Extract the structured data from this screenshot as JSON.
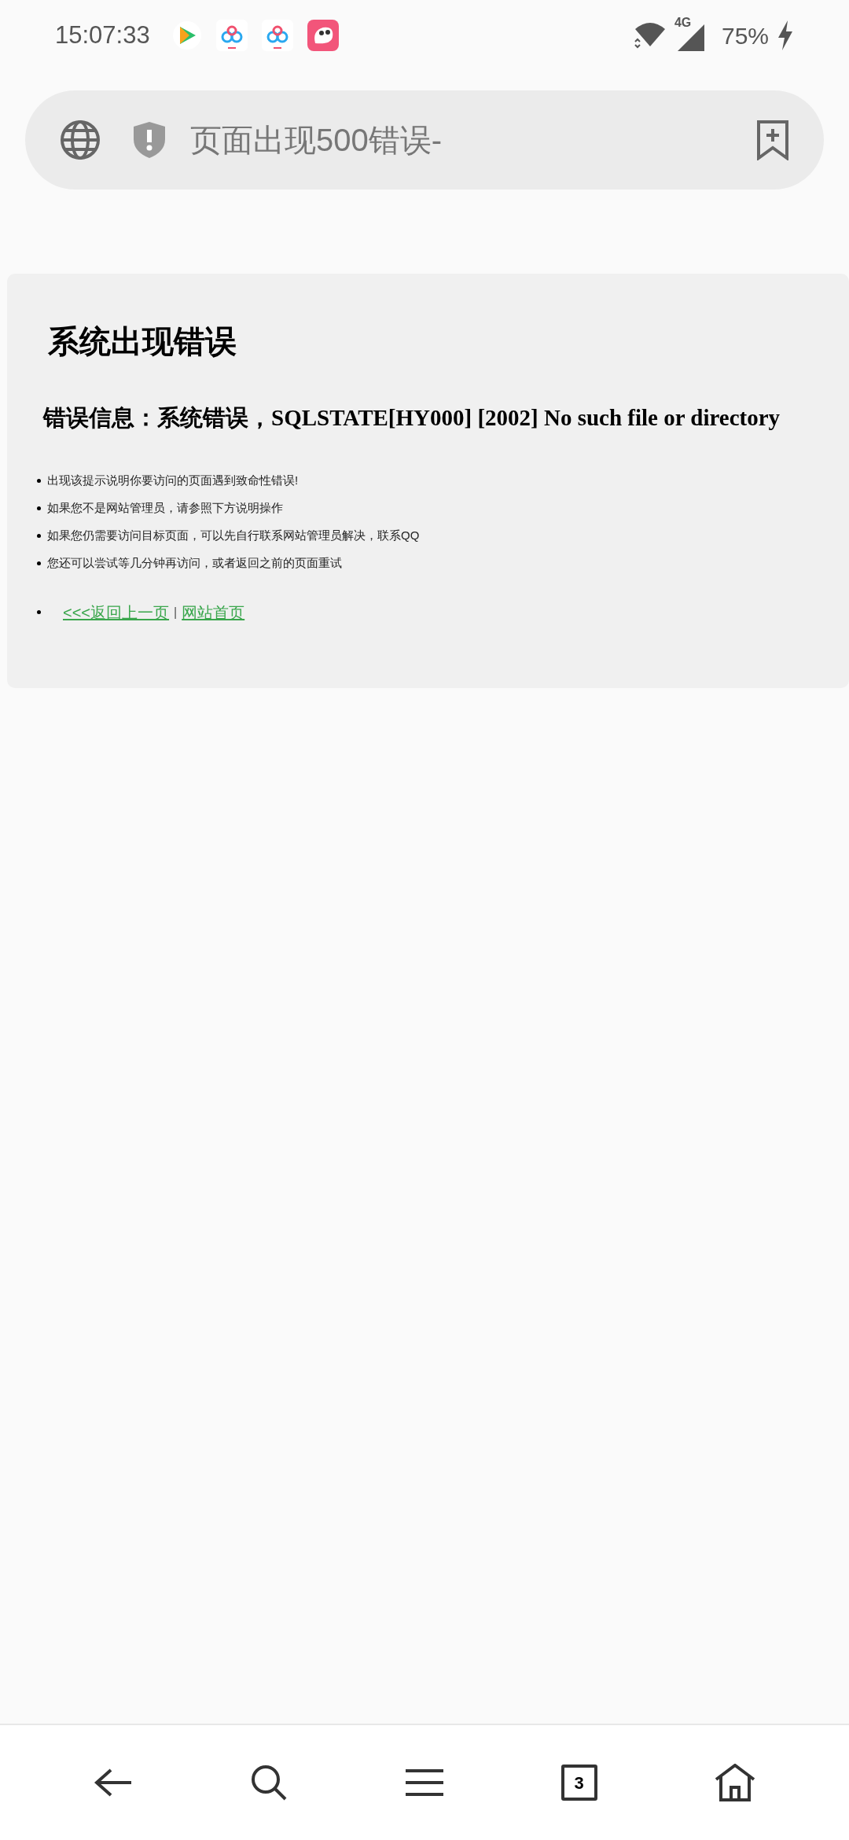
{
  "status_bar": {
    "time": "15:07:33",
    "network": "4G",
    "battery": "75%"
  },
  "address_bar": {
    "title": "页面出现500错误-"
  },
  "page": {
    "title": "系统出现错误",
    "error": "错误信息：系统错误，SQLSTATE[HY000] [2002] No such file or directory",
    "tips": [
      "出现该提示说明你要访问的页面遇到致命性错误!",
      "如果您不是网站管理员，请参照下方说明操作",
      "如果您仍需要访问目标页面，可以先自行联系网站管理员解决，联系QQ",
      "您还可以尝试等几分钟再访问，或者返回之前的页面重试"
    ],
    "links": [
      {
        "label": "<<<返回上一页"
      },
      {
        "label": "网站首页"
      }
    ],
    "link_separator": "|"
  },
  "bottom_nav": {
    "tab_count": "3"
  }
}
